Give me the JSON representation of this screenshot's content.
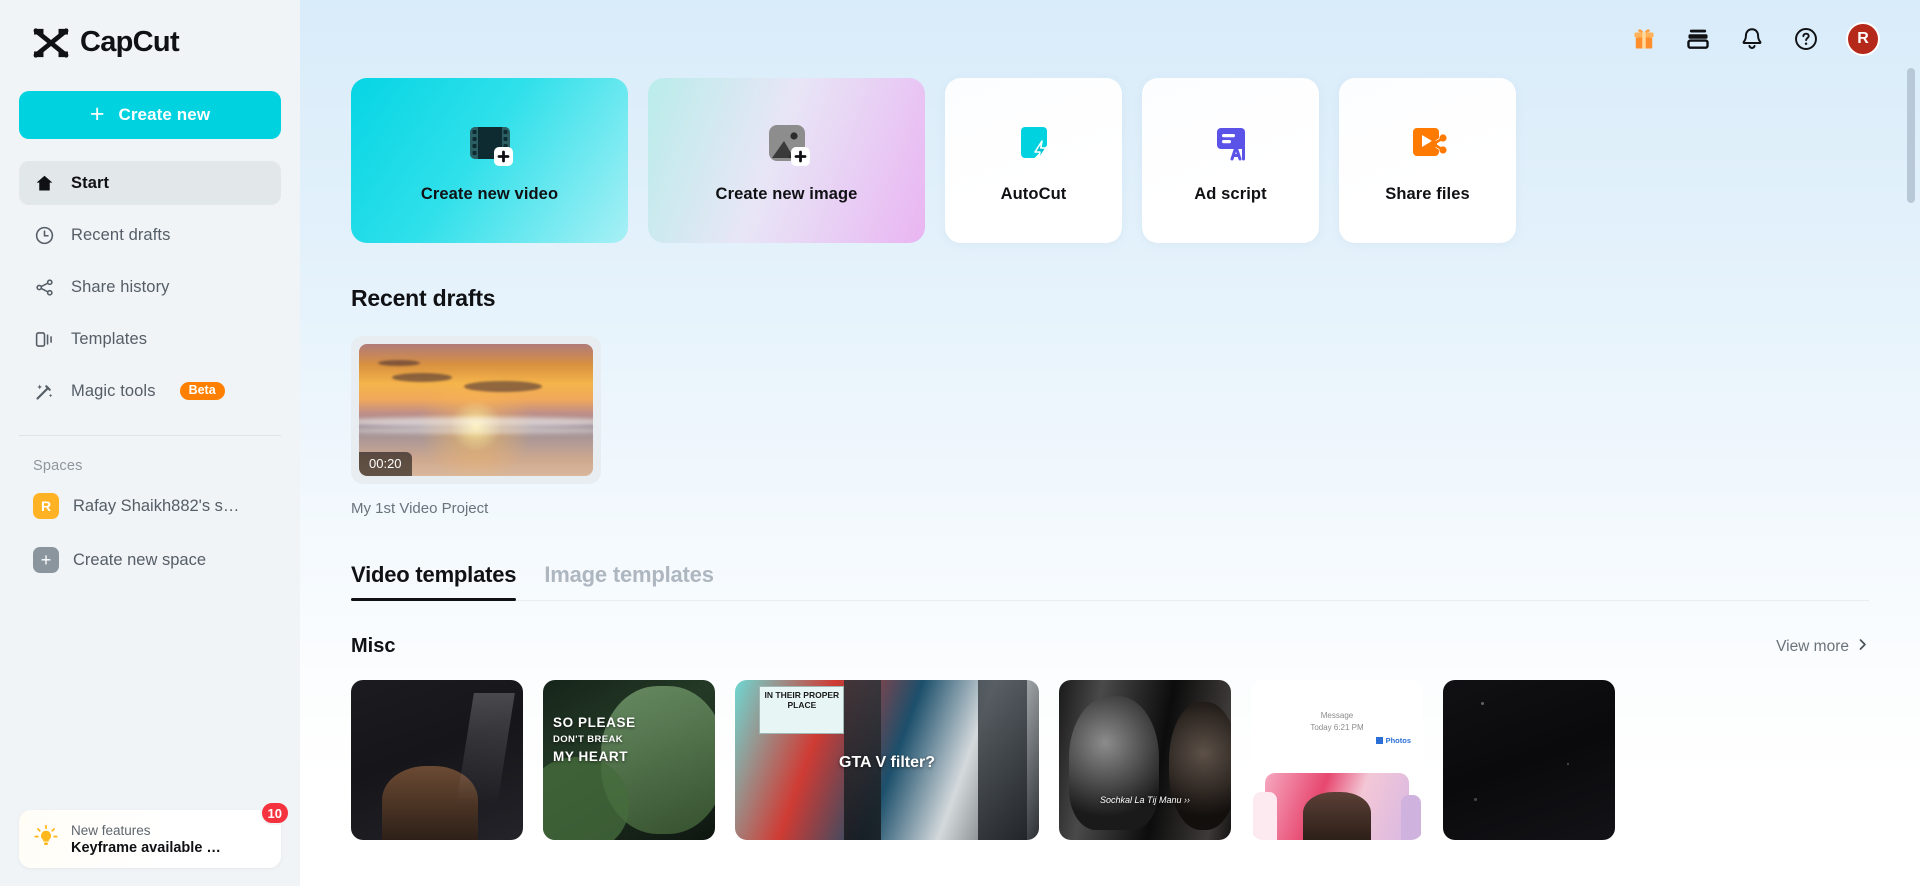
{
  "brand": {
    "name": "CapCut",
    "accent": "#00d2e0",
    "logo_icon": "capcut-logo-icon"
  },
  "sidebar": {
    "create_new_label": "Create new",
    "nav_items": [
      {
        "label": "Start",
        "icon": "home-icon",
        "active": true
      },
      {
        "label": "Recent drafts",
        "icon": "clock-icon",
        "active": false
      },
      {
        "label": "Share history",
        "icon": "share-icon",
        "active": false
      },
      {
        "label": "Templates",
        "icon": "templates-icon",
        "active": false
      },
      {
        "label": "Magic tools",
        "icon": "magic-wand-icon",
        "active": false,
        "badge": "Beta"
      }
    ],
    "spaces_label": "Spaces",
    "spaces": [
      {
        "label": "Rafay Shaikh882's s…",
        "avatar": "R",
        "icon": "space-avatar"
      },
      {
        "label": "Create new space",
        "avatar": "+",
        "icon": "plus-icon"
      }
    ],
    "promo": {
      "subtitle": "New features",
      "title": "Keyframe available …",
      "badge_count": "10",
      "icon": "lightbulb-icon"
    }
  },
  "header": {
    "icons": [
      {
        "name": "gift-icon",
        "label": "Gift"
      },
      {
        "name": "cloud-storage-icon",
        "label": "Cloud storage"
      },
      {
        "name": "bell-icon",
        "label": "Notifications"
      },
      {
        "name": "help-icon",
        "label": "Help"
      }
    ],
    "avatar_initial": "R",
    "avatar_color": "#b4291a"
  },
  "main": {
    "action_cards": [
      {
        "label": "Create new video",
        "icon": "film-plus-icon",
        "style": "video"
      },
      {
        "label": "Create new image",
        "icon": "image-plus-icon",
        "style": "image"
      },
      {
        "label": "AutoCut",
        "icon": "autocut-icon",
        "style": "plain"
      },
      {
        "label": "Ad script",
        "icon": "ad-script-ai-icon",
        "style": "plain"
      },
      {
        "label": "Share files",
        "icon": "share-files-icon",
        "style": "plain"
      }
    ],
    "recent_drafts": {
      "title": "Recent drafts",
      "items": [
        {
          "name": "My 1st Video Project",
          "duration": "00:20",
          "thumb": "sunset-beach-thumbnail"
        }
      ]
    },
    "tabs": [
      {
        "label": "Video templates",
        "active": true
      },
      {
        "label": "Image templates",
        "active": false
      }
    ],
    "misc": {
      "title": "Misc",
      "view_more_label": "View more",
      "view_more_icon": "chevron-right-icon",
      "templates": [
        {
          "caption": "",
          "style": "dark-portrait"
        },
        {
          "caption": "SO PLEASE",
          "caption2": "DON'T BREAK",
          "caption3": "MY HEART",
          "style": "plant"
        },
        {
          "caption": "GTA V filter?",
          "caption_top": "IN THEIR PROPER PLACE",
          "style": "street"
        },
        {
          "caption": "Sochkal La Tij Manu ››",
          "style": "bw-portrait"
        },
        {
          "caption": "Message",
          "caption2": "Today 6:21 PM",
          "caption3": "Photos",
          "style": "message"
        },
        {
          "caption": "",
          "style": "black"
        }
      ]
    }
  }
}
